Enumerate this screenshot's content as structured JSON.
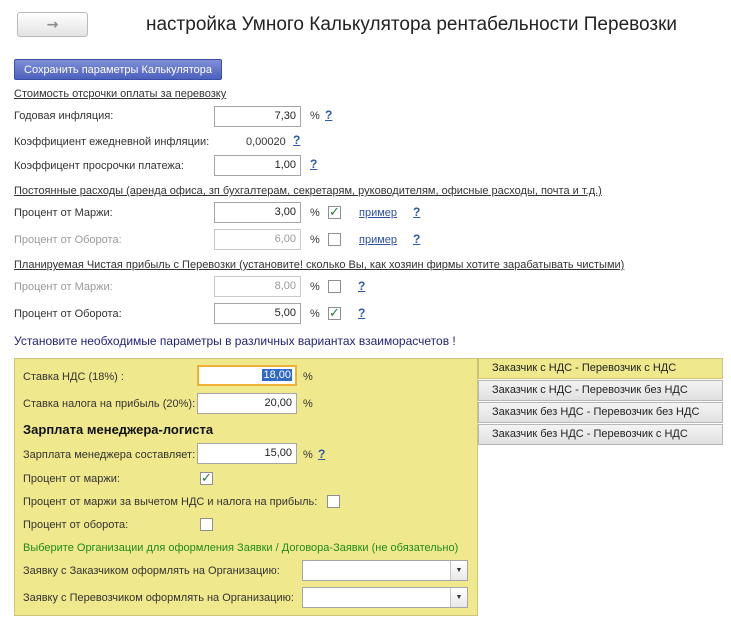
{
  "header": {
    "nav_arrow": "→",
    "title": "настройка Умного Калькулятора рентабельности Перевозки"
  },
  "toolbar": {
    "save_label": "Сохранить параметры Калькулятора"
  },
  "deferral": {
    "heading": "Стоимость отсрочки оплаты за перевозку",
    "annual_inflation_label": "Годовая инфляция:",
    "annual_inflation_value": "7,30",
    "annual_inflation_unit": "%",
    "daily_inflation_label": "Коэффициент ежедневной инфляции:",
    "daily_inflation_value": "0,00020",
    "overdue_label": "Коэффицент просрочки платежа:",
    "overdue_value": "1,00",
    "help": "?"
  },
  "fixed_costs": {
    "heading": "Постоянные расходы (аренда офиса, зп бухгалтерам, секретарям, руководителям, офисные расходы, почта и т.д.)",
    "margin_label": "Процент от Маржи:",
    "margin_value": "3,00",
    "margin_unit": "%",
    "margin_checked": true,
    "margin_link": "пример",
    "turnover_label": "Процент от Оборота:",
    "turnover_value": "6,00",
    "turnover_unit": "%",
    "turnover_checked": false,
    "turnover_link": "пример",
    "help": "?"
  },
  "net_profit": {
    "heading": "Планируемая Чистая прибыль с Перевозки (установите! сколько Вы, как хозяин фирмы хотите зарабатывать чистыми)",
    "margin_label": "Процент от Маржи:",
    "margin_value": "8,00",
    "margin_unit": "%",
    "margin_checked": false,
    "turnover_label": "Процент от Оборота:",
    "turnover_value": "5,00",
    "turnover_unit": "%",
    "turnover_checked": true,
    "help": "?"
  },
  "instruction": "Установите необходимые параметры в различных вариантах взаиморасчетов !",
  "panel": {
    "vat_label": "Ставка НДС (18%) :",
    "vat_value": "18,00",
    "vat_unit": "%",
    "profit_tax_label": "Ставка налога на прибыль (20%):",
    "profit_tax_value": "20,00",
    "profit_tax_unit": "%",
    "manager_heading": "Зарплата менеджера-логиста",
    "salary_label": "Зарплата менеджера составляет:",
    "salary_value": "15,00",
    "salary_unit": "%",
    "salary_help": "?",
    "pct_margin_label": "Процент от маржи:",
    "pct_margin_checked": true,
    "pct_margin_net_label": "Процент от маржи за вычетом НДС и налога на прибыль:",
    "pct_margin_net_checked": false,
    "pct_turnover_label": "Процент от оборота:",
    "pct_turnover_checked": false,
    "org_note": "Выберите Организации для оформления Заявки / Договора-Заявки (не обязательно)",
    "customer_org_label": "Заявку с Заказчиком оформлять на Организацию:",
    "customer_org_value": "",
    "carrier_org_label": "Заявку с Перевозчиком оформлять на Организацию:",
    "carrier_org_value": ""
  },
  "variants": [
    {
      "label": "Заказчик с НДС  - Перевозчик с НДС",
      "active": true
    },
    {
      "label": "Заказчик с НДС - Перевозчик без НДС",
      "active": false
    },
    {
      "label": "Заказчик без НДС - Перевозчик без НДС",
      "active": false
    },
    {
      "label": "Заказчик без НДС - Перевозчик с НДС",
      "active": false
    }
  ],
  "colors": {
    "panel_bg": "#f0e88c",
    "save_button": "#5a6cc6",
    "check_green": "#1d7a35",
    "note_green": "#1f8a1f",
    "link_blue": "#2c4f9e",
    "focus_orange": "#f0b236"
  }
}
